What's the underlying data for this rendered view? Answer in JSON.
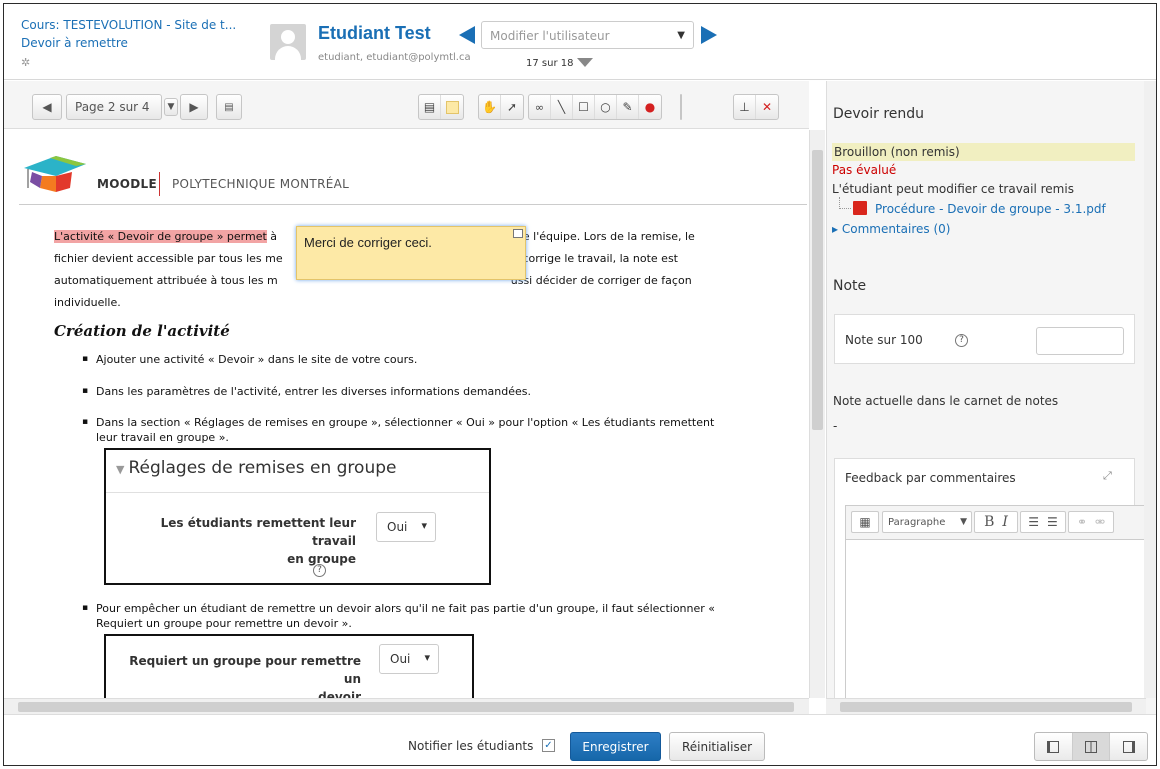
{
  "header": {
    "course_title": "Cours: TESTEVOLUTION - Site de t...",
    "course_sub": "Devoir à remettre",
    "student_name": "Etudiant Test",
    "student_meta": "etudiant, etudiant@polymtl.ca",
    "user_select_placeholder": "Modifier l'utilisateur",
    "count": "17 sur 18"
  },
  "toolbar": {
    "page_label": "Page 2 sur 4"
  },
  "document": {
    "logo_moodle": "MOODLE",
    "logo_poly": "POLYTECHNIQUE MONTRÉAL",
    "para_highlight": "L'activité « Devoir de groupe » permet",
    "para_l1_rest": " à",
    "para_l1_after": " toute l'équipe. Lors de la remise, le",
    "para_l2_a": "fichier devient accessible par tous les me",
    "para_l2_b": "t corrige le travail, la note est",
    "para_l3_a": "automatiquement attribuée à tous les m",
    "para_l3_b": "ussi décider de corriger de façon",
    "para_l4": "individuelle.",
    "annotation_text": "Merci de corriger ceci.",
    "heading": "Création de l'activité",
    "bullets": [
      "Ajouter une activité « Devoir » dans le site de votre cours.",
      "Dans les paramètres de l'activité, entrer les diverses informations demandées.",
      "Dans la section « Réglages de remises en groupe », sélectionner « Oui » pour l'option « Les étudiants remettent leur travail en groupe ».",
      "Pour empêcher un étudiant de remettre un devoir alors qu'il ne fait pas partie d'un groupe,  il faut sélectionner « Requiert un groupe pour remettre un devoir »."
    ],
    "embed1": {
      "title": "Réglages de remises en groupe",
      "label_l1": "Les étudiants remettent leur travail",
      "label_l2": "en groupe",
      "value": "Oui"
    },
    "embed2": {
      "label_l1": "Requiert un groupe pour remettre un",
      "label_l2": "devoir",
      "value": "Oui"
    }
  },
  "right": {
    "section_title": "Devoir rendu",
    "status_draft": "Brouillon (non remis)",
    "status_graded": "Pas évalué",
    "status_edit": "L'étudiant peut modifier ce travail remis",
    "file_name": "Procédure - Devoir de groupe - 3.1.pdf",
    "comments": "Commentaires (0)",
    "note_title": "Note",
    "note_label": "Note sur 100",
    "current_grade_label": "Note actuelle dans le carnet de notes",
    "current_grade_value": "-",
    "feedback_label": "Feedback par commentaires",
    "editor_format": "Paragraphe"
  },
  "footer": {
    "notify_label": "Notifier les étudiants",
    "save_label": "Enregistrer",
    "reset_label": "Réinitialiser"
  },
  "colors": {
    "accent": "#1a6fb5",
    "highlight": "#f2a4a4",
    "note": "#fde9a6",
    "status_draft_bg": "#f1efc1",
    "status_error": "#cc0000"
  }
}
